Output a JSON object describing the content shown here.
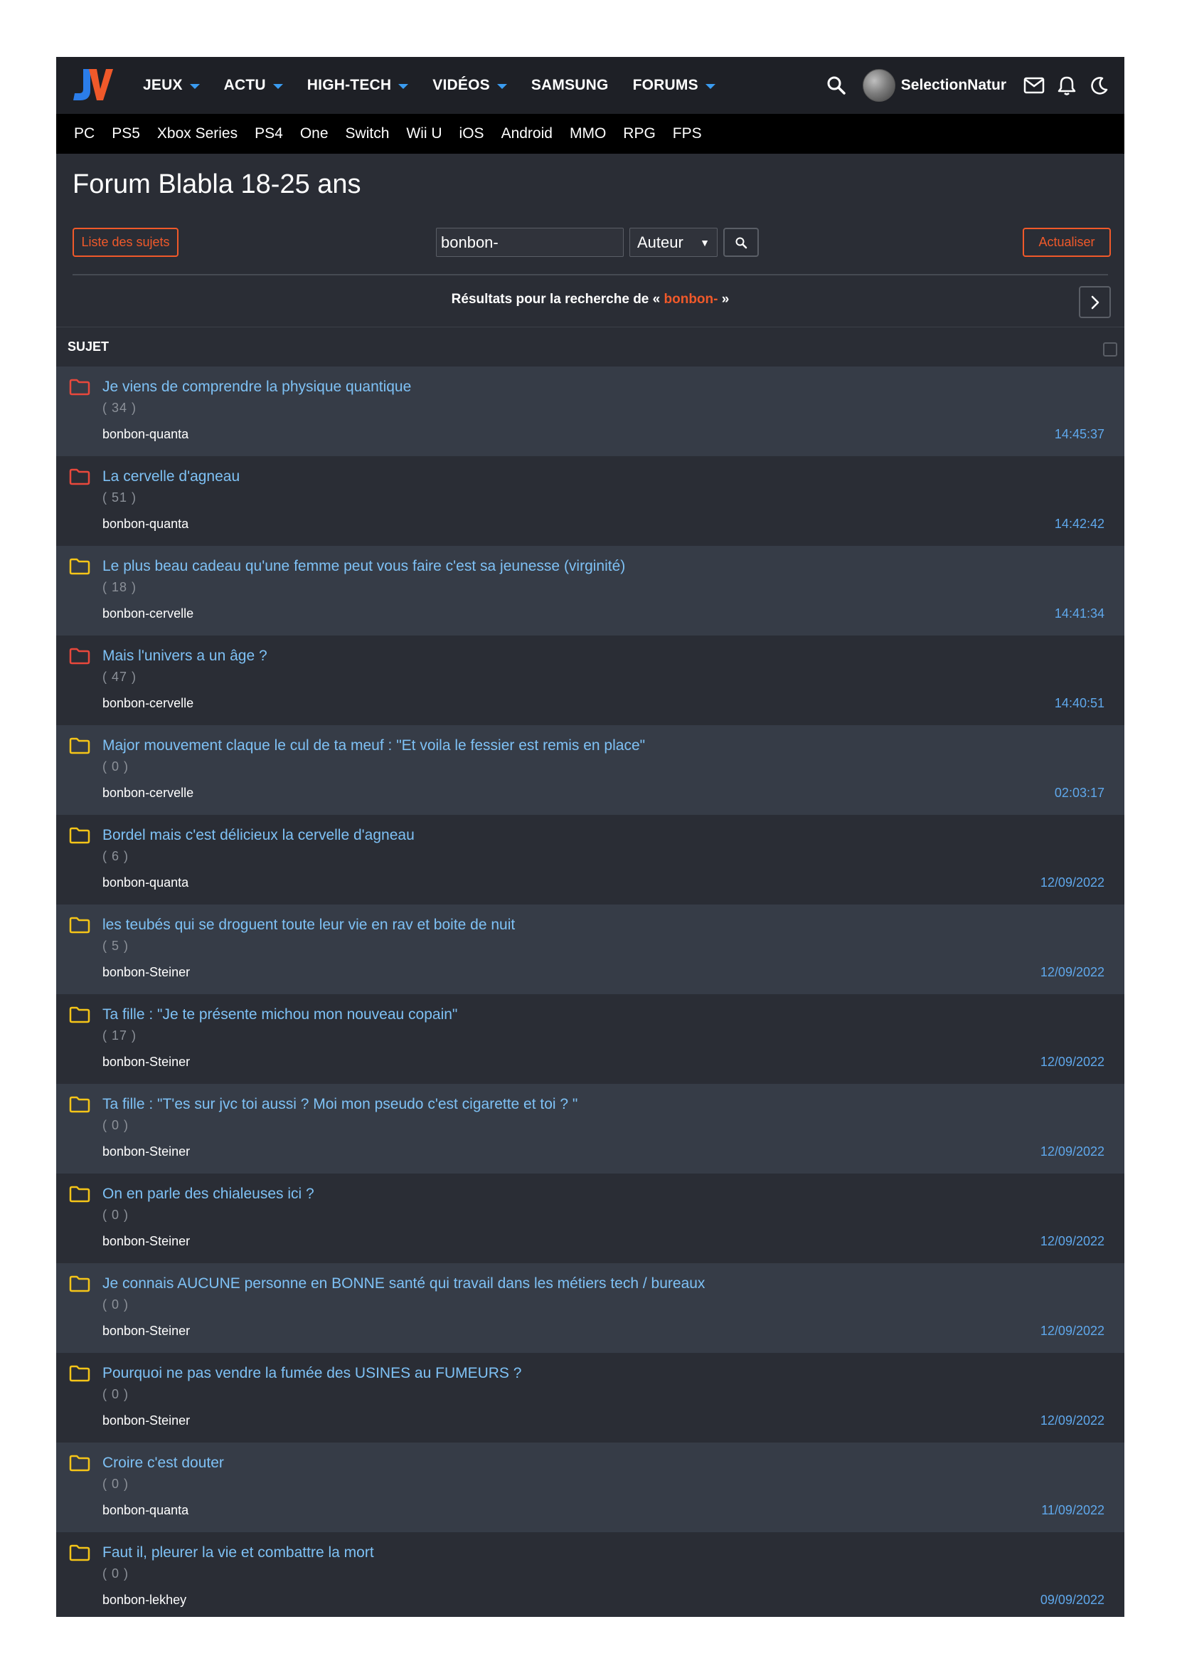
{
  "nav": {
    "menu": [
      {
        "label": "JEUX",
        "dropdown": true
      },
      {
        "label": "ACTU",
        "dropdown": true
      },
      {
        "label": "HIGH-TECH",
        "dropdown": true
      },
      {
        "label": "VIDÉOS",
        "dropdown": true
      },
      {
        "label": "SAMSUNG",
        "dropdown": false
      },
      {
        "label": "FORUMS",
        "dropdown": true
      }
    ],
    "username": "SelectionNatur",
    "icons": [
      "search-icon",
      "avatar",
      "mail-icon",
      "bell-icon",
      "moon-icon"
    ]
  },
  "platforms": [
    "PC",
    "PS5",
    "Xbox Series",
    "PS4",
    "One",
    "Switch",
    "Wii U",
    "iOS",
    "Android",
    "MMO",
    "RPG",
    "FPS"
  ],
  "page": {
    "title": "Forum Blabla 18-25 ans",
    "list_button": "Liste des sujets",
    "refresh_button": "Actualiser"
  },
  "search": {
    "value": "bonbon-",
    "mode": "Auteur",
    "results_prefix": "Résultats pour la recherche de «",
    "results_term": "bonbon-",
    "results_suffix": "»"
  },
  "table": {
    "column_header": "SUJET"
  },
  "colors": {
    "accent": "#f0592a",
    "link": "#7ec1f5",
    "folder_hot": "#e8483c",
    "folder_normal": "#f5c518",
    "time": "#5fa8ec"
  },
  "topics": [
    {
      "title": "Je viens de comprendre la physique quantique",
      "count": "( 34 )",
      "author": "bonbon-quanta",
      "time": "14:45:37",
      "folder": "hot"
    },
    {
      "title": "La cervelle d'agneau",
      "count": "( 51 )",
      "author": "bonbon-quanta",
      "time": "14:42:42",
      "folder": "hot"
    },
    {
      "title": "Le plus beau cadeau qu'une femme peut vous faire c'est sa jeunesse (virginité)",
      "count": "( 18 )",
      "author": "bonbon-cervelle",
      "time": "14:41:34",
      "folder": "normal"
    },
    {
      "title": "Mais l'univers a un âge ?",
      "count": "( 47 )",
      "author": "bonbon-cervelle",
      "time": "14:40:51",
      "folder": "hot"
    },
    {
      "title": "Major mouvement claque le cul de ta meuf : \"Et voila le fessier est remis en place\"",
      "count": "( 0 )",
      "author": "bonbon-cervelle",
      "time": "02:03:17",
      "folder": "normal"
    },
    {
      "title": "Bordel mais c'est délicieux la cervelle d'agneau",
      "count": "( 6 )",
      "author": "bonbon-quanta",
      "time": "12/09/2022",
      "folder": "normal"
    },
    {
      "title": "les teubés qui se droguent toute leur vie en rav et boite de nuit",
      "count": "( 5 )",
      "author": "bonbon-Steiner",
      "time": "12/09/2022",
      "folder": "normal"
    },
    {
      "title": "Ta fille : \"Je te présente michou mon nouveau copain\"",
      "count": "( 17 )",
      "author": "bonbon-Steiner",
      "time": "12/09/2022",
      "folder": "normal"
    },
    {
      "title": "Ta fille : \"T'es sur jvc toi aussi ? Moi mon pseudo c'est cigarette et toi ? \"",
      "count": "( 0 )",
      "author": "bonbon-Steiner",
      "time": "12/09/2022",
      "folder": "normal"
    },
    {
      "title": "On en parle des chialeuses ici ?",
      "count": "( 0 )",
      "author": "bonbon-Steiner",
      "time": "12/09/2022",
      "folder": "normal"
    },
    {
      "title": "Je connais AUCUNE personne en BONNE santé qui travail dans les métiers tech / bureaux",
      "count": "( 0 )",
      "author": "bonbon-Steiner",
      "time": "12/09/2022",
      "folder": "normal"
    },
    {
      "title": "Pourquoi ne pas vendre la fumée des USINES au FUMEURS ?",
      "count": "( 0 )",
      "author": "bonbon-Steiner",
      "time": "12/09/2022",
      "folder": "normal"
    },
    {
      "title": "Croire c'est douter",
      "count": "( 0 )",
      "author": "bonbon-quanta",
      "time": "11/09/2022",
      "folder": "normal"
    },
    {
      "title": "Faut il, pleurer la vie et combattre la mort",
      "count": "( 0 )",
      "author": "bonbon-lekhey",
      "time": "09/09/2022",
      "folder": "normal"
    }
  ]
}
